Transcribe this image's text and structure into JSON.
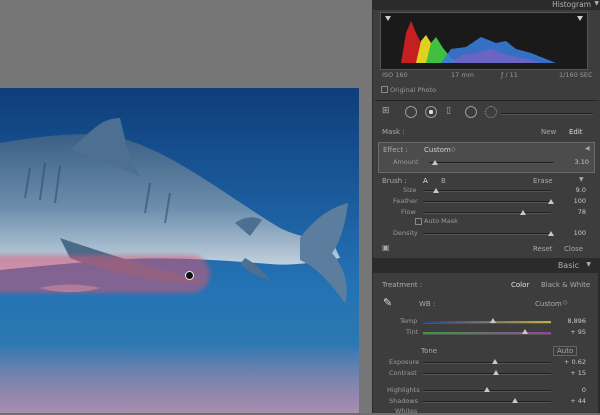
{
  "histogram": {
    "title": "Histogram",
    "iso": "ISO 160",
    "focal": "17 mm",
    "aperture": "ƒ / 11",
    "shutter": "1/160 SEC",
    "original_photo_label": "Original Photo"
  },
  "mask": {
    "label": "Mask :",
    "new": "New",
    "edit": "Edit"
  },
  "effect": {
    "label": "Effect :",
    "preset": "Custom",
    "amount_label": "Amount",
    "amount_value": "3.10",
    "amount_level": 0.05
  },
  "brush": {
    "label": "Brush :",
    "tab_a": "A",
    "tab_b": "B",
    "erase": "Erase",
    "rows": [
      {
        "label": "Size",
        "value": "9.0",
        "level": 0.1
      },
      {
        "label": "Feather",
        "value": "100",
        "level": 1.0
      },
      {
        "label": "Flow",
        "value": "78",
        "level": 0.78
      }
    ],
    "auto_mask": "Auto Mask",
    "density_label": "Density",
    "density_value": "100",
    "density_level": 1.0,
    "reset": "Reset",
    "close": "Close"
  },
  "basic": {
    "title": "Basic",
    "treatment_label": "Treatment :",
    "color": "Color",
    "bw": "Black & White",
    "wb_label": "WB :",
    "wb_value": "Custom",
    "temp_label": "Temp",
    "temp_value": "8,896",
    "temp_level": 0.55,
    "tint_label": "Tint",
    "tint_value": "+ 95",
    "tint_level": 0.8,
    "tone_label": "Tone",
    "auto": "Auto",
    "exposure_label": "Exposure",
    "exposure_value": "+ 0.62",
    "exposure_level": 0.56,
    "contrast_label": "Contrast",
    "contrast_value": "+ 15",
    "contrast_level": 0.57,
    "highlights_label": "Highlights",
    "highlights_value": "0",
    "highlights_level": 0.5,
    "shadows_label": "Shadows",
    "shadows_value": "+ 44",
    "shadows_level": 0.72,
    "whites_label": "Whites"
  }
}
